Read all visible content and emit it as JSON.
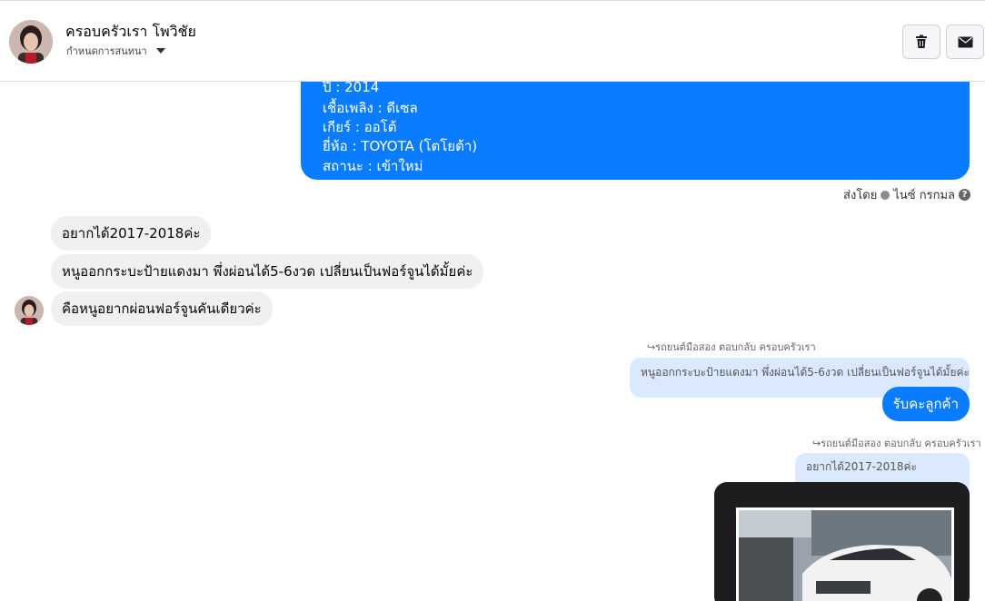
{
  "header": {
    "contact_name": "ครอบครัวเรา โพวิชัย",
    "subtitle": "กำหนดการสนทนา",
    "delete_icon": "trash-icon",
    "mail_icon": "envelope-icon"
  },
  "car_info_card": {
    "year": "ปี : 2014",
    "fuel": "เชื้อเพลิง : ดีเซล",
    "gear": "เกียร์ : ออโต้",
    "brand": "ยี่ห้อ : TOYOTA (โตโยต้า)",
    "status": "สถานะ : เข้าใหม่"
  },
  "sent_by": {
    "prefix": "ส่งโดย",
    "sender": "ไนซ์ กรกมล"
  },
  "incoming_messages": [
    "อยากได้2017-2018ค่ะ",
    "หนูออกกระบะป้ายแดงมา พึ่งผ่อนได้5-6งวด เปลี่ยนเป็นฟอร์จูนได้มั้ยค่ะ",
    "คือหนูอยากผ่อนฟอร์จูนคันเดียวค่ะ"
  ],
  "replies": [
    {
      "label": "รถยนต์มือสอง ตอบกลับ ครอบครัวเรา",
      "quoted": "หนูออกกระบะป้ายแดงมา พึ่งผ่อนได้5-6งวด เปลี่ยนเป็นฟอร์จูนได้มั้ยค่ะ",
      "reply": "รับคะลูกค้า"
    },
    {
      "label": "รถยนต์มือสอง ตอบกลับ ครอบครัวเรา",
      "quoted": "อยากได้2017-2018ค่ะ"
    }
  ],
  "colors": {
    "accent": "#0a7cff",
    "incoming_bg": "#f0f0f0",
    "quote_bg": "#dbe9ff"
  }
}
